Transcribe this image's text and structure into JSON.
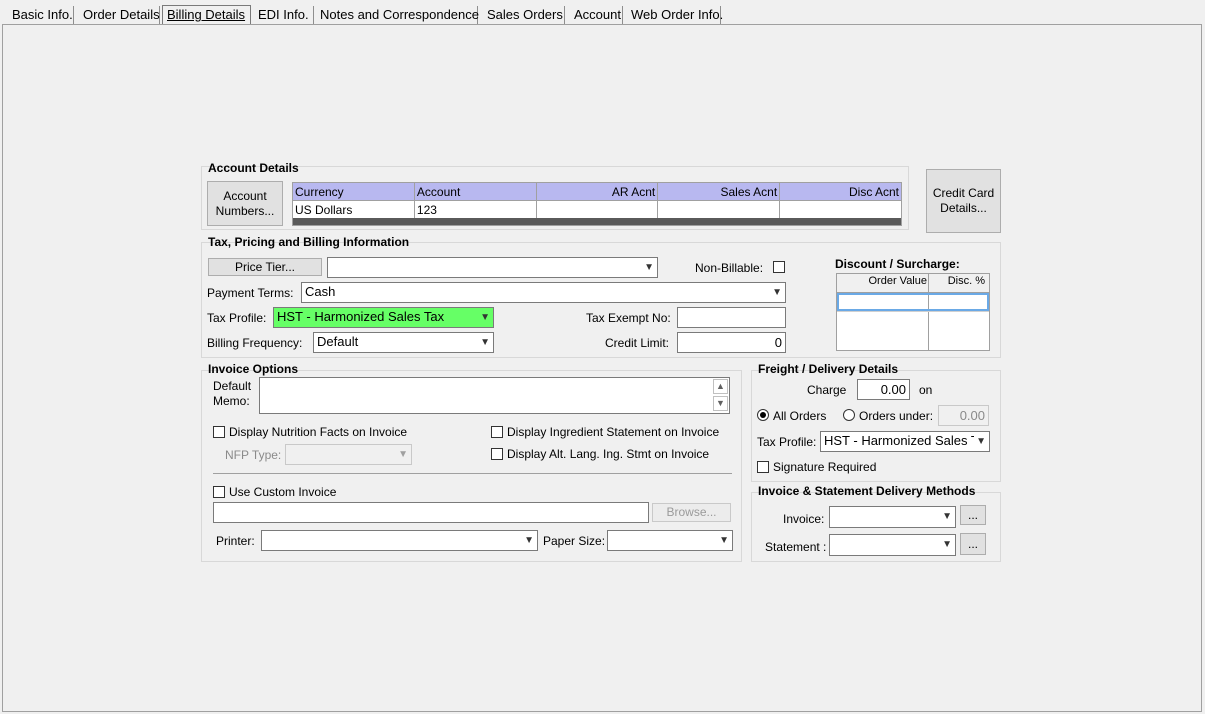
{
  "tabs": [
    {
      "label": "Basic Info."
    },
    {
      "label": "Order Details"
    },
    {
      "label": "Billing Details"
    },
    {
      "label": "EDI Info."
    },
    {
      "label": "Notes and Correspondence"
    },
    {
      "label": "Sales Orders"
    },
    {
      "label": "Account"
    },
    {
      "label": "Web Order Info."
    }
  ],
  "account_details": {
    "title": "Account Details",
    "account_numbers_button": "Account Numbers...",
    "columns": [
      "Currency",
      "Account",
      "AR Acnt",
      "Sales Acnt",
      "Disc Acnt"
    ],
    "rows": [
      [
        "US Dollars",
        "123",
        "",
        "",
        ""
      ]
    ]
  },
  "credit_card_button": "Credit Card Details...",
  "tax": {
    "title": "Tax, Pricing and Billing Information",
    "price_tier_button": "Price Tier...",
    "price_tier_value": "",
    "non_billable_label": "Non-Billable:",
    "payment_terms_label": "Payment Terms:",
    "payment_terms_value": "Cash",
    "tax_profile_label": "Tax Profile:",
    "tax_profile_value": "HST - Harmonized Sales Tax",
    "tax_profile_color": "#66ff66",
    "tax_exempt_label": "Tax Exempt No:",
    "tax_exempt_value": "",
    "billing_freq_label": "Billing Frequency:",
    "billing_freq_value": "Default",
    "credit_limit_label": "Credit Limit:",
    "credit_limit_value": "0"
  },
  "discount": {
    "title": "Discount / Surcharge:",
    "columns": [
      "Order Value",
      "Disc. %"
    ]
  },
  "invoice_options": {
    "title": "Invoice Options",
    "default_memo_label_1": "Default",
    "default_memo_label_2": "Memo:",
    "nutrition_label": "Display Nutrition Facts on Invoice",
    "ingredient_label": "Display Ingredient Statement on Invoice",
    "nfp_type_label": "NFP Type:",
    "alt_lang_label": "Display Alt. Lang. Ing. Stmt on Invoice",
    "custom_invoice_label": "Use Custom Invoice",
    "browse_button": "Browse...",
    "printer_label": "Printer:",
    "paper_size_label": "Paper Size:"
  },
  "freight": {
    "title": "Freight / Delivery Details",
    "charge_label": "Charge",
    "charge_value": "0.00",
    "on_label": "on",
    "all_orders_label": "All Orders",
    "orders_under_label": "Orders under:",
    "orders_under_value": "0.00",
    "tax_profile_label": "Tax Profile:",
    "tax_profile_value": "HST - Harmonized Sales T",
    "signature_label": "Signature Required"
  },
  "delivery": {
    "title": "Invoice & Statement Delivery Methods",
    "invoice_label": "Invoice:",
    "statement_label": "Statement :",
    "ellipsis": "..."
  }
}
